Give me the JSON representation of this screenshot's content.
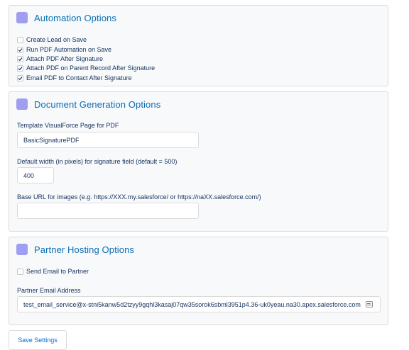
{
  "automation": {
    "title": "Automation Options",
    "options": [
      {
        "label": "Create Lead on Save",
        "checked": false
      },
      {
        "label": "Run PDF Automation on Save",
        "checked": true
      },
      {
        "label": "Attach PDF After Signature",
        "checked": true
      },
      {
        "label": "Attach PDF on Parent Record After Signature",
        "checked": true
      },
      {
        "label": "Email PDF to Contact After Signature",
        "checked": true
      }
    ]
  },
  "document_generation": {
    "title": "Document Generation Options",
    "template_label": "Template VisualForce Page for PDF",
    "template_value": "BasicSignaturePDF",
    "width_label": "Default width (in pixels) for signature field (default = 500)",
    "width_value": "400",
    "base_url_label": "Base URL for images (e.g. https://XXX.my.salesforce/ or https://naXX.salesforce.com/)",
    "base_url_value": ""
  },
  "partner_hosting": {
    "title": "Partner Hosting Options",
    "send_email_label": "Send Email to Partner",
    "send_email_checked": false,
    "email_label": "Partner Email Address",
    "email_value": "test_email_service@x-stni5kanw5d2tzyy9gqhl3kasaj07qw35sorok6sbml3951p4.36-uk0yeau.na30.apex.salesforce.com"
  },
  "save_button": "Save Settings",
  "colors": {
    "accent_icon": "#a09ef0",
    "title_text": "#0a6eb4",
    "link_blue": "#0070d2"
  }
}
